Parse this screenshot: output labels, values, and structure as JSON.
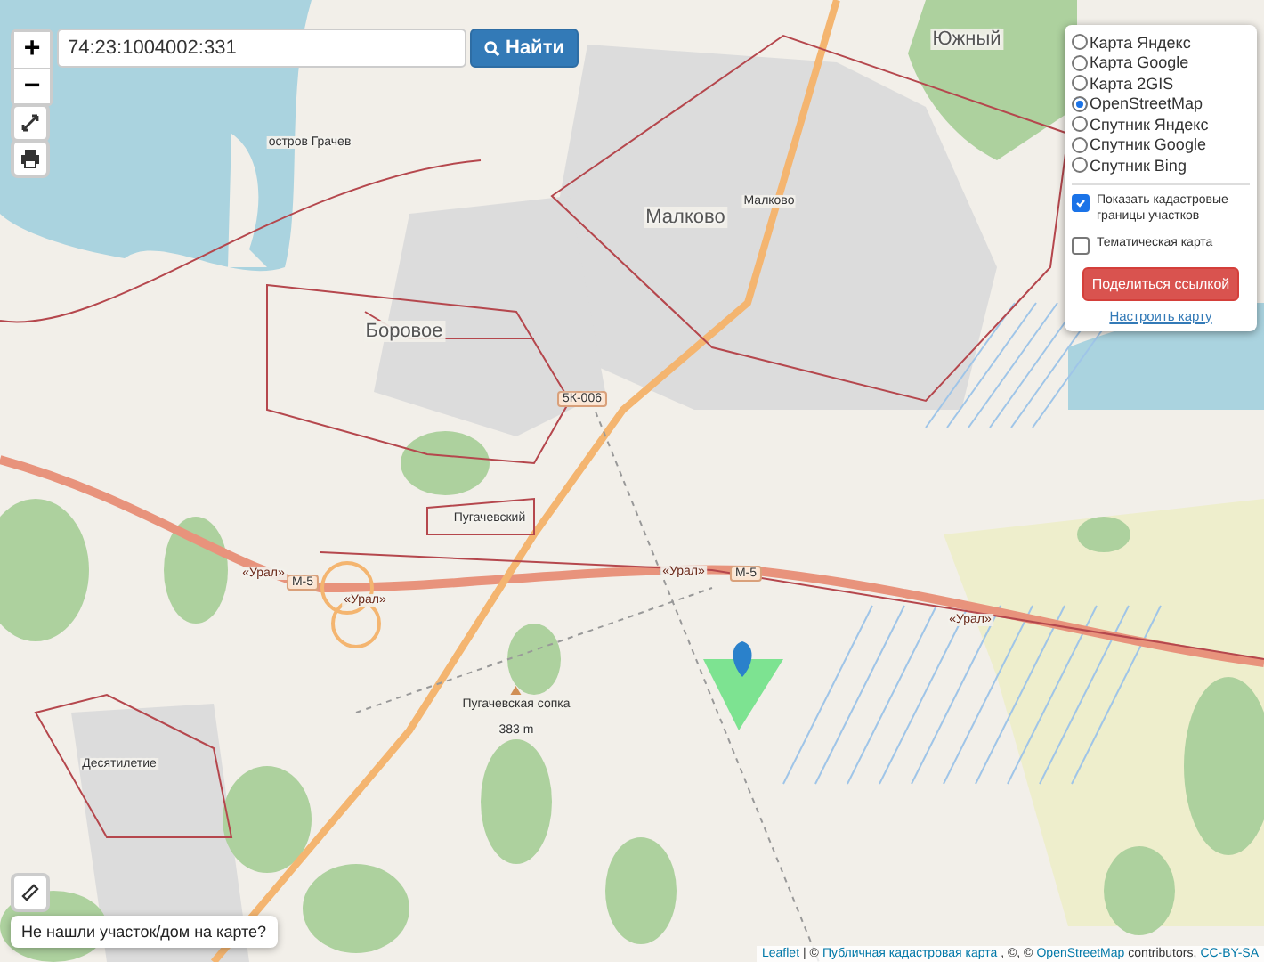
{
  "search": {
    "value": "74:23:1004002:331",
    "button": "Найти"
  },
  "zoom": {
    "in": "+",
    "out": "−"
  },
  "layers": [
    {
      "label": "Карта Яндекс",
      "selected": false
    },
    {
      "label": "Карта Google",
      "selected": false
    },
    {
      "label": "Карта 2GIS",
      "selected": false
    },
    {
      "label": "OpenStreetMap",
      "selected": true
    },
    {
      "label": "Спутник Яндекс",
      "selected": false
    },
    {
      "label": "Спутник Google",
      "selected": false
    },
    {
      "label": "Спутник Bing",
      "selected": false
    }
  ],
  "options": [
    {
      "label": "Показать кадастровые границы участков",
      "checked": true
    },
    {
      "label": "Тематическая карта",
      "checked": false
    }
  ],
  "share_button": "Поделиться ссылкой",
  "settings_link": "Настроить карту",
  "report_button": "Не нашли участок/дом на карте?",
  "map_labels": [
    {
      "kind": "town",
      "text": "Южный"
    },
    {
      "kind": "town",
      "text": "Малково"
    },
    {
      "kind": "small",
      "text": "Малково"
    },
    {
      "kind": "town",
      "text": "Боровое"
    },
    {
      "kind": "small",
      "text": "остров Грачев"
    },
    {
      "kind": "shield",
      "text": "5К-006"
    },
    {
      "kind": "small",
      "text": "Пугачевский"
    },
    {
      "kind": "shield",
      "text": "М-5"
    },
    {
      "kind": "road",
      "text": "«Урал»"
    },
    {
      "kind": "road",
      "text": "«Урал»"
    },
    {
      "kind": "road",
      "text": "«Урал»"
    },
    {
      "kind": "shield",
      "text": "М-5"
    },
    {
      "kind": "road",
      "text": "«Урал»"
    },
    {
      "kind": "peak",
      "text": "Пугачевская сопка"
    },
    {
      "kind": "small",
      "text": "383 m"
    },
    {
      "kind": "small",
      "text": "Десятилетие"
    }
  ],
  "attribution": [
    {
      "kind": "link",
      "text": "Leaflet"
    },
    {
      "kind": "text",
      "text": "| ©"
    },
    {
      "kind": "link",
      "text": "Публичная кадастровая карта"
    },
    {
      "kind": "text",
      "text": ", ©, ©"
    },
    {
      "kind": "link",
      "text": "OpenStreetMap"
    },
    {
      "kind": "text",
      "text": "contributors,"
    },
    {
      "kind": "link",
      "text": "CC-BY-SA"
    }
  ]
}
